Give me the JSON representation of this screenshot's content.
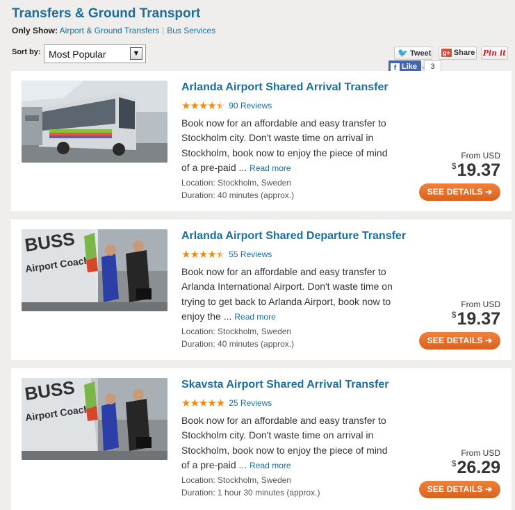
{
  "page_title": "Transfers & Ground Transport",
  "filters": {
    "label": "Only Show:",
    "items": [
      "Airport & Ground Transfers",
      "Bus Services"
    ],
    "separator": "|"
  },
  "sort": {
    "label": "Sort by:",
    "value": "Most Popular"
  },
  "social": {
    "tweet": "Tweet",
    "share": "Share",
    "pin": "Pin it",
    "like": "Like",
    "like_count": "3"
  },
  "colors": {
    "accent": "#1a6f9e",
    "button": "#e36f26",
    "stars": "#f28a0b"
  },
  "products": [
    {
      "title": "Arlanda Airport Shared Arrival Transfer",
      "rating": 4.5,
      "stars": "★★★★★",
      "reviews": "90 Reviews",
      "description": "Book now for an affordable and easy transfer to Stockholm city. Don't waste time on arrival in Stockholm, book now to enjoy the piece of mind of a pre-paid ...",
      "read_more": "Read more",
      "location": "Location: Stockholm, Sweden",
      "duration": "Duration: 40 minutes (approx.)",
      "from_label": "From USD",
      "currency": "$",
      "price": "19.37",
      "button": "SEE DETAILS",
      "image": "airport-bus-photo"
    },
    {
      "title": "Arlanda Airport Shared Departure Transfer",
      "rating": 4.5,
      "stars": "★★★★★",
      "reviews": "55 Reviews",
      "description": "Book now for an affordable and easy transfer to Arlanda International Airport. Don't waste time on trying to get back to Arlanda Airport, book now to enjoy the ...",
      "read_more": "Read more",
      "location": "Location: Stockholm, Sweden",
      "duration": "Duration: 40 minutes (approx.)",
      "from_label": "From USD",
      "currency": "$",
      "price": "19.37",
      "button": "SEE DETAILS",
      "image": "driver-handshake-photo"
    },
    {
      "title": "Skavsta Airport Shared Arrival Transfer",
      "rating": 5,
      "stars": "★★★★★",
      "reviews": "25 Reviews",
      "description": "Book now for an affordable and easy transfer to Stockholm city. Don't waste time on arrival in Stockholm, book now to enjoy the piece of mind of a pre-paid ...",
      "read_more": "Read more",
      "location": "Location: Stockholm, Sweden",
      "duration": "Duration: 1 hour 30 minutes (approx.)",
      "from_label": "From USD",
      "currency": "$",
      "price": "26.29",
      "button": "SEE DETAILS",
      "image": "driver-handshake-photo"
    }
  ]
}
